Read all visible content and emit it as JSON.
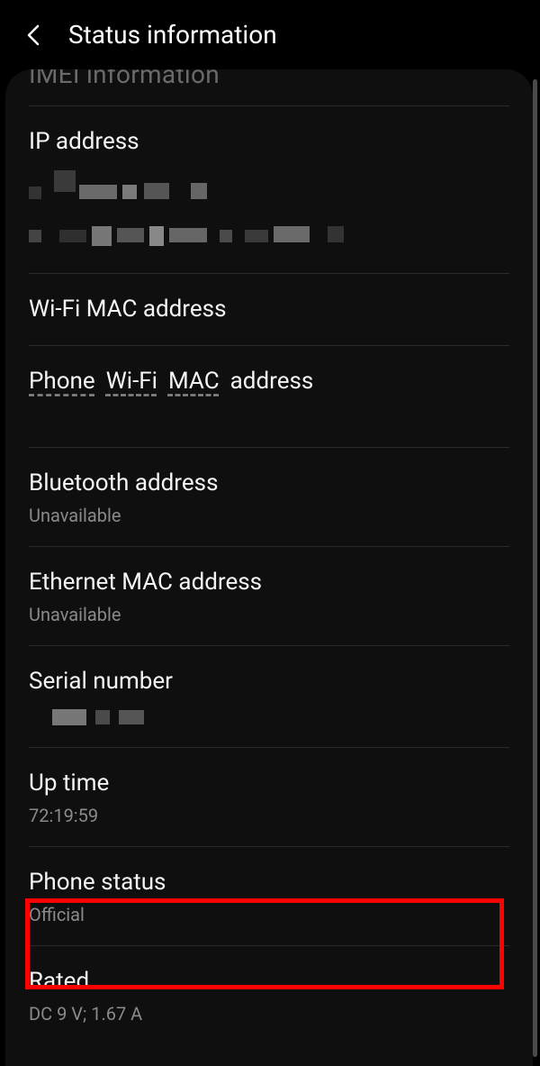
{
  "header": {
    "title": "Status information"
  },
  "cutoff_row": {
    "label": "IMEI information"
  },
  "rows": {
    "ip_address": {
      "label": "IP address"
    },
    "wifi_mac": {
      "label": "Wi-Fi MAC address"
    },
    "phone_wifi_mac": {
      "prefix": "Phone",
      "wifi": "Wi-Fi",
      "mac": "MAC",
      "suffix": "address"
    },
    "bluetooth": {
      "label": "Bluetooth address",
      "value": "Unavailable"
    },
    "ethernet": {
      "label": "Ethernet MAC address",
      "value": "Unavailable"
    },
    "serial": {
      "label": "Serial number"
    },
    "uptime": {
      "label": "Up time",
      "value": "72:19:59"
    },
    "phone_status": {
      "label": "Phone status",
      "value": "Official"
    },
    "rated": {
      "label": "Rated",
      "value": "DC 9 V; 1.67 A"
    }
  }
}
